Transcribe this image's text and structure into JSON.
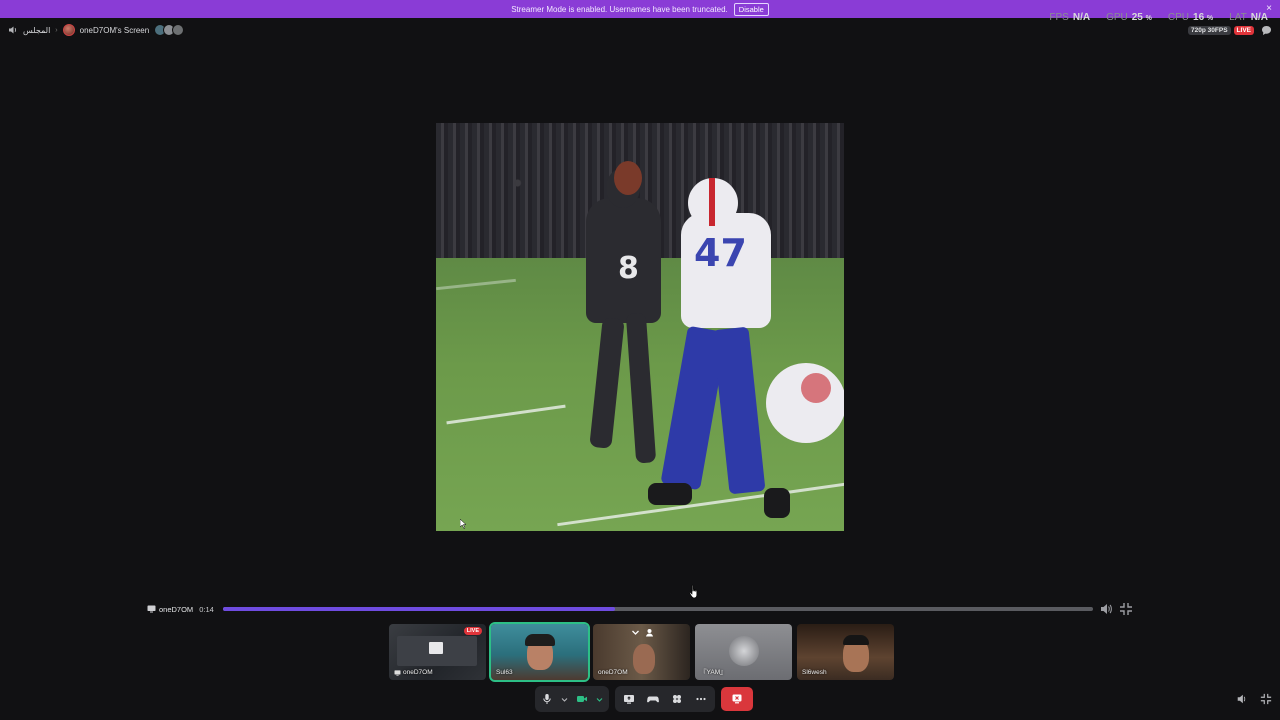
{
  "banner": {
    "text": "Streamer Mode is enabled. Usernames have been truncated.",
    "button_label": "Disable",
    "close_glyph": "×"
  },
  "topbar": {
    "channel_name": "المجلس",
    "separator": "›",
    "stream_title": "oneD7OM's Screen"
  },
  "stats": {
    "fps_label": "FPS",
    "fps_value": "N/A",
    "gpu_label": "GPU",
    "gpu_value": "25",
    "cpu_label": "CPU",
    "cpu_value": "16",
    "lat_label": "LAT",
    "lat_value": "N/A",
    "percent": "%"
  },
  "stream_badges": {
    "quality": "720p 30FPS",
    "live": "LIVE"
  },
  "player": {
    "presenter": "oneD7OM",
    "elapsed": "0:14",
    "progress": 0.45
  },
  "video": {
    "jersey_dark": "8",
    "jersey_white": "47"
  },
  "participants": [
    {
      "name": "oneD7OM",
      "live": "LIVE",
      "sharing": true
    },
    {
      "name": "Sul63",
      "speaking": true
    },
    {
      "name": "oneD7OM"
    },
    {
      "name": "『YAM』"
    },
    {
      "name": "Sl6wesh"
    }
  ],
  "colors": {
    "accent": "#6f4ce0",
    "banner": "#8a3cd6",
    "live": "#e0343a",
    "speaking": "#2dbf86",
    "end_call": "#da373c"
  },
  "icons": [
    "speaker-icon",
    "microphone-icon",
    "camera-icon",
    "screen-share-icon",
    "activity-icon",
    "soundboard-icon",
    "more-icon",
    "end-call-icon",
    "volume-icon",
    "fullscreen-exit-icon",
    "chat-icon"
  ]
}
